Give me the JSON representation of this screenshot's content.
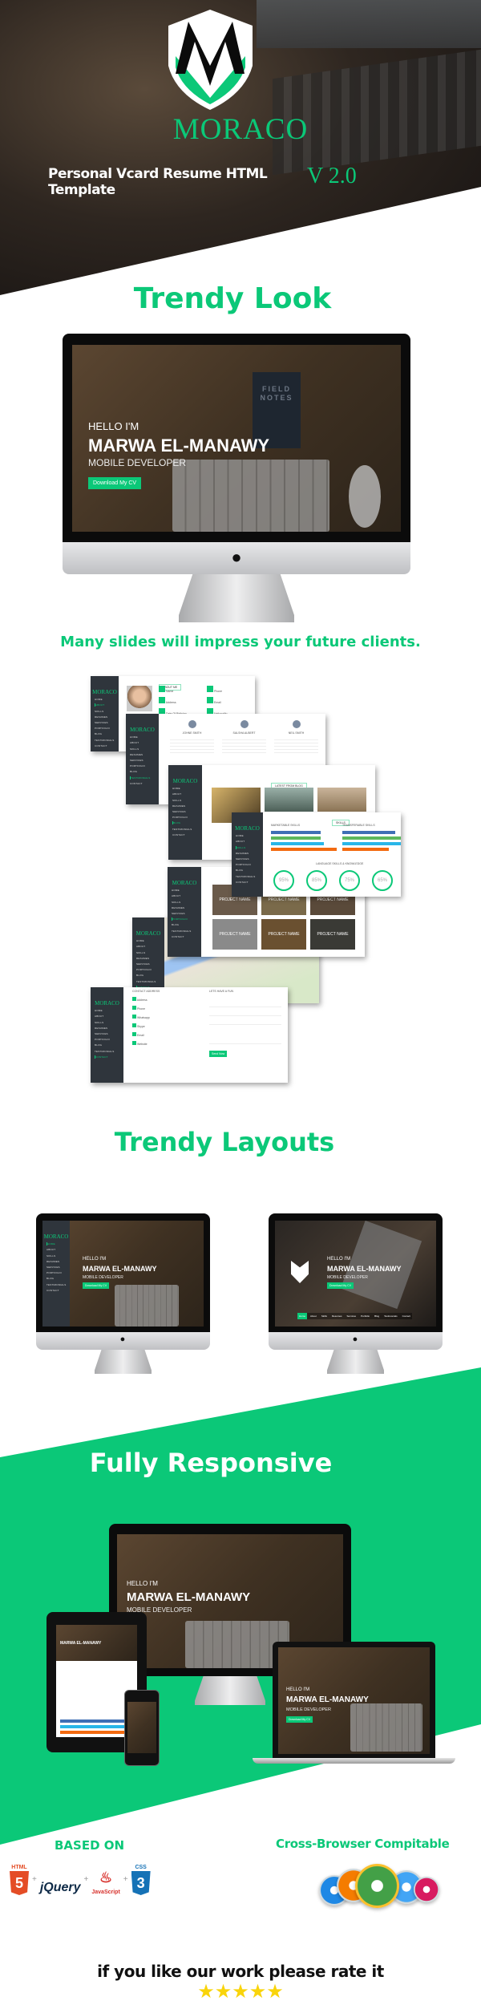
{
  "header": {
    "brand": "MORACO",
    "tagline": "Personal Vcard Resume HTML Template",
    "version": "V 2.0"
  },
  "colors": {
    "accent": "#0bc878",
    "sidebar": "#2f353c",
    "star": "#f9d40b"
  },
  "sections": {
    "trendy_look": "Trendy Look",
    "slides_caption": "Many slides will impress your future clients.",
    "trendy_layouts": "Trendy Layouts",
    "fully_responsive": "Fully Responsive",
    "based_on": "BASED ON",
    "cross_browser": "Cross-Browser Compitable",
    "rate": "if you like our work please rate it"
  },
  "hero_screen": {
    "hello": "HELLO I'M",
    "name": "MARWA EL-MANAWY",
    "role": "MOBILE  DEVELOPER",
    "cta": "Download My CV",
    "notebook": "FIELD NOTES"
  },
  "menu": [
    "HOME",
    "ABOUT",
    "SKILLS",
    "RESUMES",
    "SERVICES",
    "PORTFOLIO",
    "BLOG",
    "TESTIMONIALS",
    "CONTACT"
  ],
  "slides": {
    "about": {
      "title": "ABOUT ME",
      "fields": [
        "Name",
        "Phone",
        "Address",
        "Email",
        "Date Of Birthday",
        "Nationality"
      ]
    },
    "testimonials": {
      "names": [
        "JOHNE SMITH",
        "SALSHA ALBERT",
        "NEIL SMITH"
      ]
    },
    "blog": {
      "title": "LATEST FROM BLOG"
    },
    "skills": {
      "title": "SKILLS",
      "left": "MARKETABLE SKILLS",
      "right": "TRANSFERABLE SKILLS",
      "languages": "LANGUAGE SKILLS & KNOWLEDGE",
      "percents": [
        "95%",
        "85%",
        "75%",
        "65%"
      ]
    },
    "portfolio": {
      "project": "PROJECT NAME"
    },
    "contact": {
      "left": "CONTACT ADDRESS",
      "right": "LETS HAVE A FUN",
      "items": [
        "Address",
        "Phone",
        "Whatsapp",
        "Skype",
        "Email",
        "Website"
      ],
      "send": "Send Now"
    }
  },
  "layout2_nav": [
    "Home",
    "About",
    "Skills",
    "Resumes",
    "Services",
    "Portfolio",
    "Blog",
    "Testimonials",
    "Contact"
  ],
  "tech": [
    {
      "label": "HTML",
      "icon": "html5-icon",
      "color": "#e44d26"
    },
    {
      "label": "jQuery",
      "icon": "jquery-icon",
      "color": "#0769ad"
    },
    {
      "label": "JavaScript",
      "icon": "java-icon",
      "color": "#d7302b"
    },
    {
      "label": "CSS",
      "icon": "css3-icon",
      "color": "#1572b6"
    }
  ],
  "browsers": [
    {
      "icon": "ie-icon",
      "color": "#1e88e5"
    },
    {
      "icon": "firefox-icon",
      "color": "#f57c00"
    },
    {
      "icon": "chrome-icon",
      "color": "#43a047"
    },
    {
      "icon": "safari-icon",
      "color": "#42a5f5"
    },
    {
      "icon": "opera-icon",
      "color": "#d81b60"
    }
  ],
  "rating": {
    "stars": 5,
    "max": 5
  }
}
